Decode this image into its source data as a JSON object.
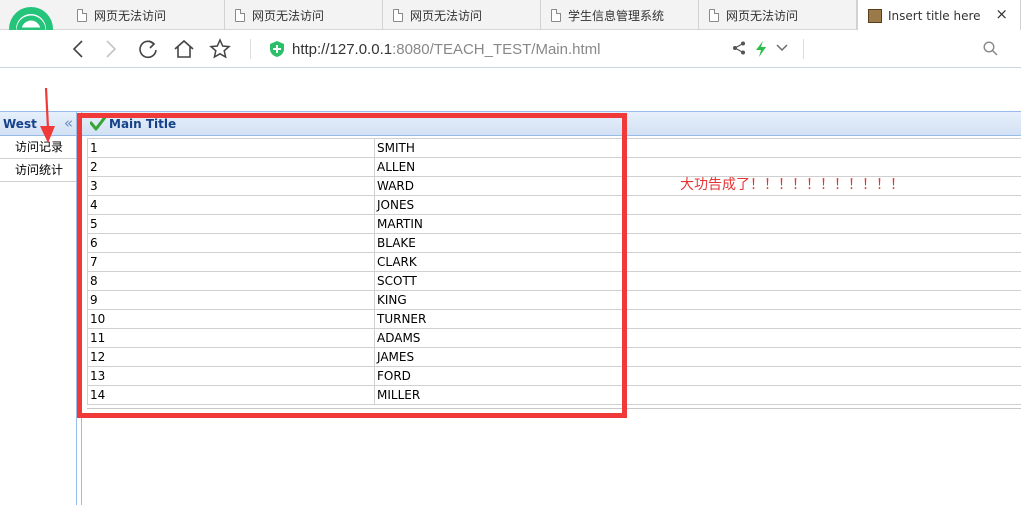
{
  "browser": {
    "tabs": [
      {
        "label": "网页无法访问"
      },
      {
        "label": "网页无法访问"
      },
      {
        "label": "网页无法访问"
      },
      {
        "label": "学生信息管理系统"
      },
      {
        "label": "网页无法访问"
      },
      {
        "label": "Insert title here",
        "active": true
      }
    ],
    "close_glyph": "×",
    "url_host": "http://127.0.0.1",
    "url_rest": ":8080/TEACH_TEST/Main.html",
    "icons": [
      "back-icon",
      "forward-icon",
      "refresh-icon",
      "home-icon",
      "star-icon",
      "shield-icon",
      "share-icon",
      "bolt-icon",
      "chevron-down-icon",
      "search-icon"
    ]
  },
  "west": {
    "title": "West",
    "collapse_glyph": "«",
    "items": [
      "访问记录",
      "访问统计"
    ]
  },
  "main": {
    "title": "Main Title",
    "rows": [
      {
        "id": "1",
        "name": "SMITH"
      },
      {
        "id": "2",
        "name": "ALLEN"
      },
      {
        "id": "3",
        "name": "WARD"
      },
      {
        "id": "4",
        "name": "JONES"
      },
      {
        "id": "5",
        "name": "MARTIN"
      },
      {
        "id": "6",
        "name": "BLAKE"
      },
      {
        "id": "7",
        "name": "CLARK"
      },
      {
        "id": "8",
        "name": "SCOTT"
      },
      {
        "id": "9",
        "name": "KING"
      },
      {
        "id": "10",
        "name": "TURNER"
      },
      {
        "id": "11",
        "name": "ADAMS"
      },
      {
        "id": "12",
        "name": "JAMES"
      },
      {
        "id": "13",
        "name": "FORD"
      },
      {
        "id": "14",
        "name": "MILLER"
      }
    ]
  },
  "message": "大功告成了！！！！！！！！！！！",
  "colors": {
    "annotation": "#f03a3a",
    "message": "#e53535",
    "header_text": "#15428b",
    "panel_border": "#99bbe8"
  }
}
